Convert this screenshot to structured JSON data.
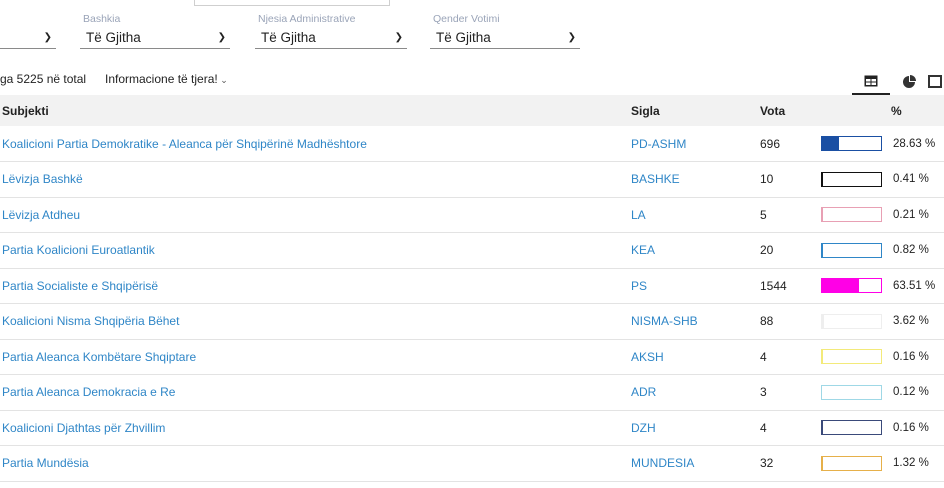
{
  "filters": [
    {
      "label": "",
      "value": ""
    },
    {
      "label": "Bashkia",
      "value": "Të Gjitha"
    },
    {
      "label": "Njesia Administrative",
      "value": "Të Gjitha"
    },
    {
      "label": "Qender Votimi",
      "value": "Të Gjitha"
    }
  ],
  "summary": {
    "count_text": "ga 5225 në total",
    "more_info_label": "Informacione të tjera!"
  },
  "view_tabs": [
    {
      "icon": "table-icon",
      "active": true
    },
    {
      "icon": "pie-chart-icon",
      "active": false
    },
    {
      "icon": "bar-chart-icon",
      "active": false
    }
  ],
  "table": {
    "headers": {
      "subject": "Subjekti",
      "acronym": "Sigla",
      "votes": "Vota",
      "percent": "%"
    },
    "rows": [
      {
        "subject": "Koalicioni Partia Demokratike - Aleanca për Shqipërinë Madhështore",
        "acronym": "PD-ASHM",
        "votes": "696",
        "percent_text": "28.63 %",
        "share": 0.2863,
        "color": "#1a4fa3"
      },
      {
        "subject": "Lëvizja Bashkë",
        "acronym": "BASHKE",
        "votes": "10",
        "percent_text": "0.41 %",
        "share": 0.0041,
        "color": "#111111"
      },
      {
        "subject": "Lëvizja Atdheu",
        "acronym": "LA",
        "votes": "5",
        "percent_text": "0.21 %",
        "share": 0.0021,
        "color": "#e8a0b4"
      },
      {
        "subject": "Partia Koalicioni Euroatlantik",
        "acronym": "KEA",
        "votes": "20",
        "percent_text": "0.82 %",
        "share": 0.0082,
        "color": "#2f86c7"
      },
      {
        "subject": "Partia Socialiste e Shqipërisë",
        "acronym": "PS",
        "votes": "1544",
        "percent_text": "63.51 %",
        "share": 0.6351,
        "color": "#ff00e6"
      },
      {
        "subject": "Koalicioni Nisma Shqipëria Bëhet",
        "acronym": "NISMA-SHB",
        "votes": "88",
        "percent_text": "3.62 %",
        "share": 0.0362,
        "color": "#eeeeee"
      },
      {
        "subject": "Partia Aleanca Kombëtare Shqiptare",
        "acronym": "AKSH",
        "votes": "4",
        "percent_text": "0.16 %",
        "share": 0.0016,
        "color": "#f3ea7a"
      },
      {
        "subject": "Partia Aleanca Demokracia e Re",
        "acronym": "ADR",
        "votes": "3",
        "percent_text": "0.12 %",
        "share": 0.0012,
        "color": "#9fd8e6"
      },
      {
        "subject": "Koalicioni Djathtas për Zhvillim",
        "acronym": "DZH",
        "votes": "4",
        "percent_text": "0.16 %",
        "share": 0.0016,
        "color": "#3a4a7a"
      },
      {
        "subject": "Partia Mundësia",
        "acronym": "MUNDESIA",
        "votes": "32",
        "percent_text": "1.32 %",
        "share": 0.0132,
        "color": "#e6b04a"
      }
    ]
  }
}
